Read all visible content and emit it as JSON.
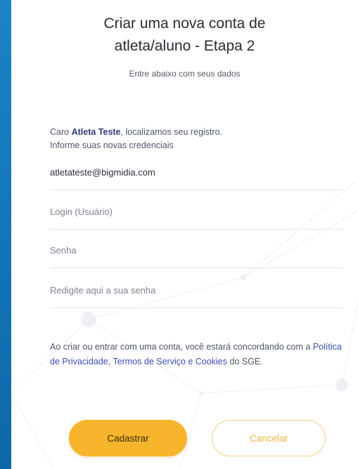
{
  "form": {
    "title_line1": "Criar uma nova conta de",
    "title_line2": "atleta/aluno - Etapa 2",
    "subtitle": "Entre abaixo com seus dados",
    "greeting_prefix": "Caro ",
    "athlete_name": "Atleta Teste",
    "greeting_suffix": ", localizamos seu registro.",
    "greeting_line2": "Informe suas novas credenciais",
    "email_value": "atletateste@bigmidia.com",
    "login_placeholder": "Login (Usuário)",
    "password_placeholder": "Senha",
    "password_confirm_placeholder": "Redigite aqui a sua senha",
    "consent_prefix": "Ao criar ou entrar com uma conta, você estará concordando com a ",
    "privacy_link": "Política de Privacidade",
    "consent_sep": ", ",
    "terms_link": "Termos de Serviço e Cookies",
    "consent_suffix": " do SGE.",
    "submit_label": "Cadastrar",
    "cancel_label": "Cancelar"
  },
  "colors": {
    "background": "#0f6fb3",
    "primary_button": "#f6b52c",
    "link": "#3a4db8",
    "athlete_name": "#2e3a78"
  }
}
